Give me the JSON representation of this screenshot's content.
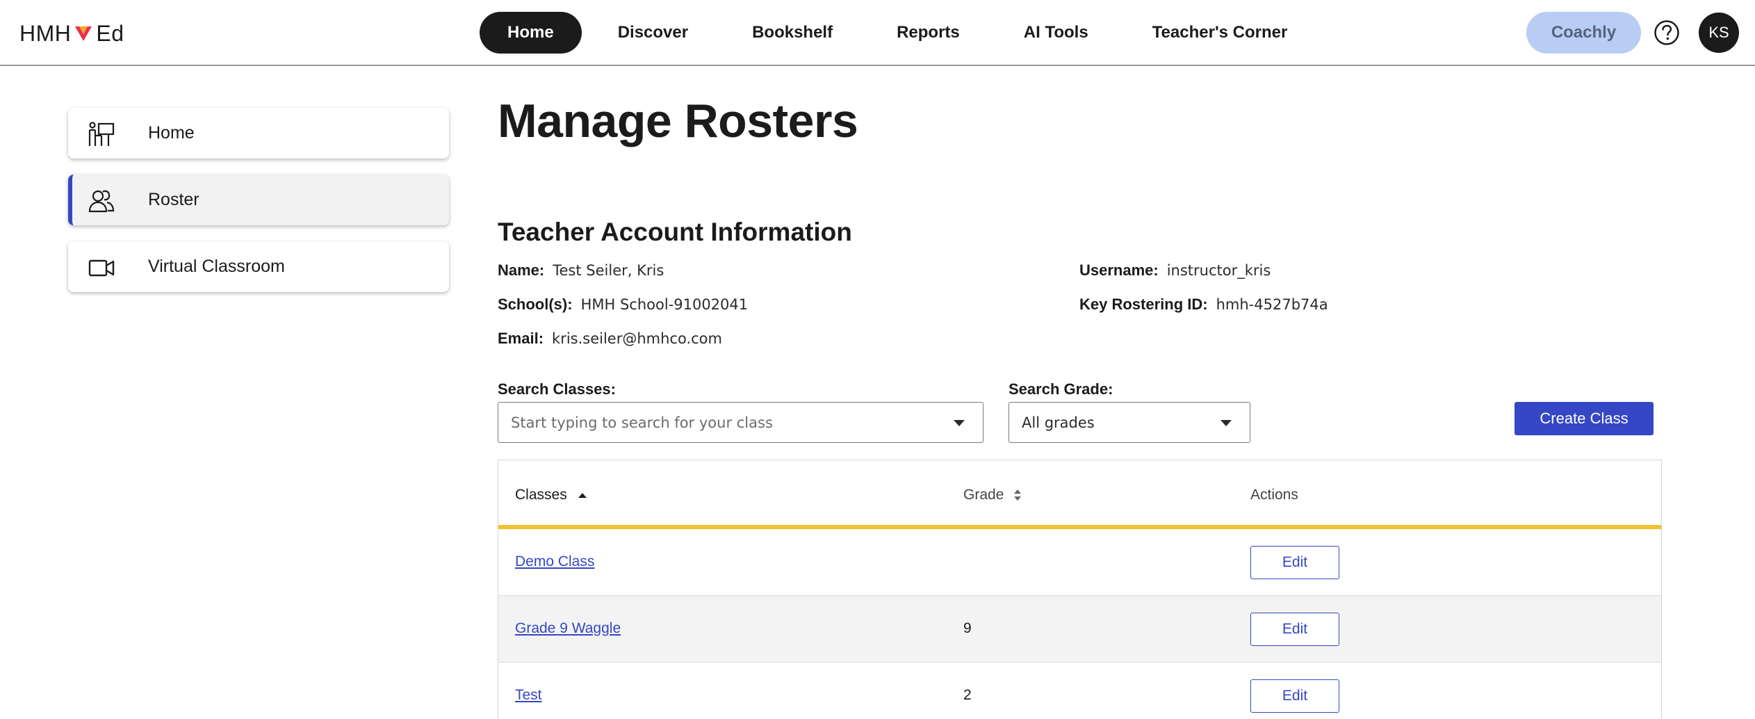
{
  "brand": {
    "logo_left": "HMH",
    "logo_right": "Ed",
    "accent": "#3547c4",
    "logo_mark_color": "#e8304e"
  },
  "nav": {
    "items": [
      {
        "label": "Home",
        "active": true
      },
      {
        "label": "Discover",
        "active": false
      },
      {
        "label": "Bookshelf",
        "active": false
      },
      {
        "label": "Reports",
        "active": false
      },
      {
        "label": "AI Tools",
        "active": false
      },
      {
        "label": "Teacher's Corner",
        "active": false
      }
    ],
    "coachly": "Coachly",
    "help_icon": "help-icon",
    "avatar_initials": "KS"
  },
  "sidebar": {
    "items": [
      {
        "label": "Home",
        "icon": "teacher-board-icon",
        "active": false
      },
      {
        "label": "Roster",
        "icon": "users-icon",
        "active": true
      },
      {
        "label": "Virtual Classroom",
        "icon": "video-camera-icon",
        "active": false
      }
    ]
  },
  "main": {
    "title": "Manage Rosters",
    "account": {
      "heading": "Teacher Account Information",
      "name_label": "Name:",
      "name_value": "Test Seiler, Kris",
      "school_label": "School(s):",
      "school_value": "HMH School-91002041",
      "email_label": "Email:",
      "email_value": "kris.seiler@hmhco.com",
      "username_label": "Username:",
      "username_value": "instructor_kris",
      "rostering_label": "Key Rostering ID:",
      "rostering_value": "hmh-4527b74a"
    },
    "search": {
      "classes_label": "Search Classes:",
      "classes_placeholder": "Start typing to search for your class",
      "grade_label": "Search Grade:",
      "grade_value": "All grades"
    },
    "create_button": "Create Class",
    "table": {
      "headers": {
        "classes": "Classes",
        "grade": "Grade",
        "actions": "Actions"
      },
      "rows": [
        {
          "class": "Demo Class",
          "grade": "",
          "action": "Edit"
        },
        {
          "class": "Grade 9 Waggle",
          "grade": "9",
          "action": "Edit"
        },
        {
          "class": "Test",
          "grade": "2",
          "action": "Edit"
        }
      ]
    }
  }
}
